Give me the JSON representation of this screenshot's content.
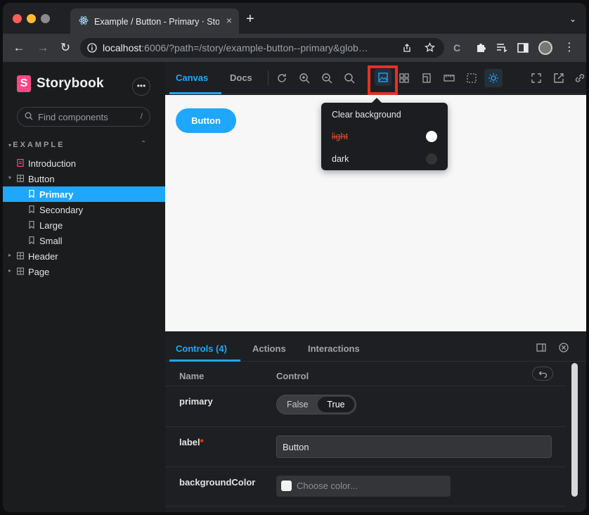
{
  "browser": {
    "tab_title": "Example / Button - Primary ⋅ Storybook",
    "tab_close": "×",
    "new_tab": "+",
    "tab_menu": "⌄",
    "url_host": "localhost",
    "url_rest": ":6006/?path=/story/example-button--primary&glob…",
    "back": "←",
    "forward": "→",
    "reload": "↻"
  },
  "sidebar": {
    "brand": "Storybook",
    "brand_mark": "S",
    "more": "•••",
    "search_placeholder": "Find components",
    "search_key": "/",
    "group": "EXAMPLE",
    "group_toggle": "⌃",
    "items": [
      {
        "label": "Introduction"
      },
      {
        "label": "Button"
      },
      {
        "label": "Primary"
      },
      {
        "label": "Secondary"
      },
      {
        "label": "Large"
      },
      {
        "label": "Small"
      },
      {
        "label": "Header"
      },
      {
        "label": "Page"
      }
    ]
  },
  "toolbar": {
    "tabs": [
      "Canvas",
      "Docs"
    ]
  },
  "canvas": {
    "story_button": "Button"
  },
  "backgrounds_popover": {
    "clear": "Clear background",
    "options": [
      {
        "label": "light",
        "color": "#ffffff"
      },
      {
        "label": "dark",
        "color": "#333333"
      }
    ]
  },
  "addons": {
    "tabs": [
      "Controls (4)",
      "Actions",
      "Interactions"
    ],
    "header": {
      "name": "Name",
      "control": "Control"
    },
    "rows": {
      "primary": {
        "name": "primary",
        "false_label": "False",
        "true_label": "True"
      },
      "label": {
        "name": "label",
        "required": "*",
        "value": "Button"
      },
      "backgroundColor": {
        "name": "backgroundColor",
        "placeholder": "Choose color..."
      }
    }
  },
  "colors": {
    "accent": "#1ea7fd",
    "brand": "#ff4785",
    "highlight_box": "#e3312a"
  }
}
